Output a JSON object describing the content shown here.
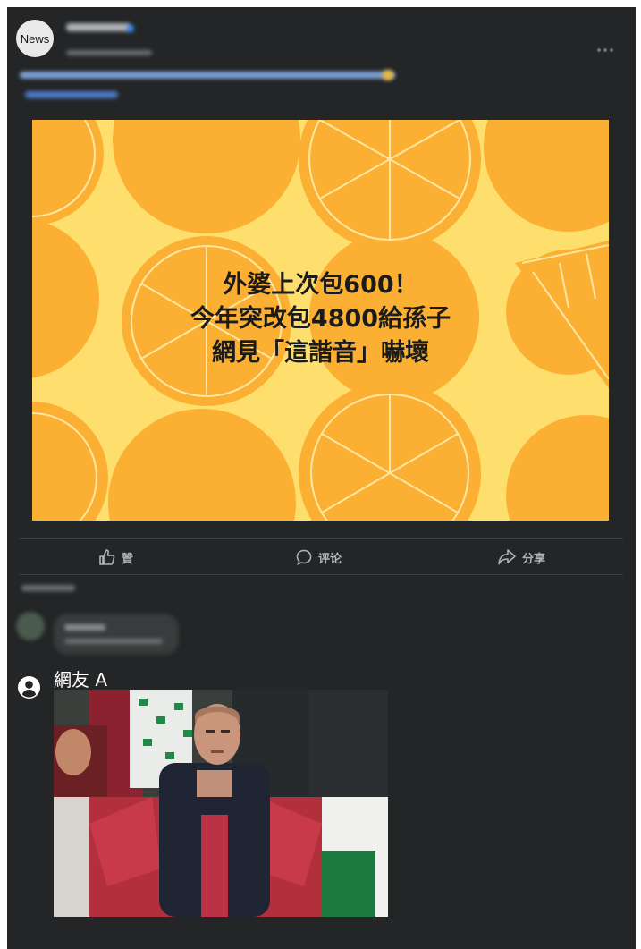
{
  "post": {
    "page_avatar_label": "News",
    "hero": {
      "headline_lines": [
        "外婆上次包600！",
        "今年突改包4800給孫子",
        "網見「這諧音」嚇壞"
      ],
      "background_color": "#fedf6e",
      "orange_color": "#fbb034"
    },
    "actions": {
      "like": "贊",
      "comment": "评论",
      "share": "分享"
    }
  },
  "reply": {
    "user_name": "網友 A",
    "meme_icon": "frustrated-fan-photo"
  },
  "icons": [
    "more-icon",
    "like-icon",
    "comment-icon",
    "share-icon",
    "user-icon"
  ]
}
